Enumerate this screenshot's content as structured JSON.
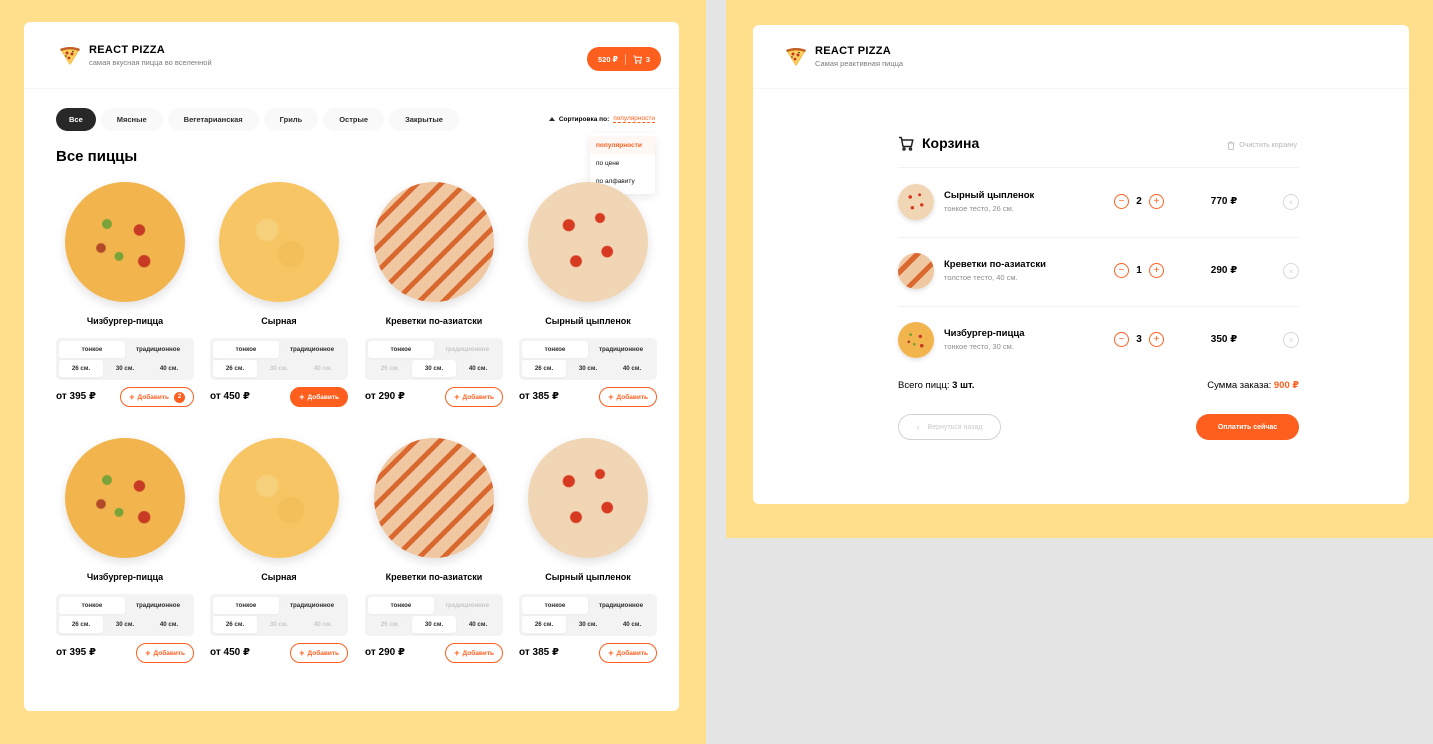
{
  "colors": {
    "accent": "#fe5f1e",
    "background": "#ffdf8c",
    "dark": "#282828"
  },
  "catalog": {
    "header": {
      "title": "REACT PIZZA",
      "subtitle": "самая вкусная пицца во вселенной",
      "cart_price": "520 ₽",
      "cart_count": "3",
      "cart_icon": "cart-icon"
    },
    "categories": [
      "Все",
      "Мясные",
      "Вегетарианская",
      "Гриль",
      "Острые",
      "Закрытые"
    ],
    "active_category": "Все",
    "sort": {
      "label": "Сортировка по:",
      "value": "популярности",
      "options": [
        "популярности",
        "по цене",
        "по алфавиту"
      ]
    },
    "section_title": "Все пиццы",
    "add_label": "Добавить",
    "pizzas": [
      {
        "name": "Чизбургер-пицца",
        "price": "от 395 ₽",
        "types": [
          "тонкое",
          "традиционное"
        ],
        "sizes": [
          "26 см.",
          "30 см.",
          "40 см."
        ],
        "added_count": "2"
      },
      {
        "name": "Сырная",
        "price": "от 450 ₽",
        "types": [
          "тонкое",
          "традиционное"
        ],
        "sizes": [
          "26 см.",
          "30 см.",
          "40 см."
        ]
      },
      {
        "name": "Креветки по-азиатски",
        "price": "от 290 ₽",
        "types": [
          "тонкое",
          "традиционное"
        ],
        "sizes": [
          "26 см.",
          "30 см.",
          "40 см."
        ]
      },
      {
        "name": "Сырный цыпленок",
        "price": "от 385 ₽",
        "types": [
          "тонкое",
          "традиционное"
        ],
        "sizes": [
          "26 см.",
          "30 см.",
          "40 см."
        ]
      },
      {
        "name": "Чизбургер-пицца",
        "price": "от 395 ₽",
        "types": [
          "тонкое",
          "традиционное"
        ],
        "sizes": [
          "26 см.",
          "30 см.",
          "40 см."
        ]
      },
      {
        "name": "Сырная",
        "price": "от 450 ₽",
        "types": [
          "тонкое",
          "традиционное"
        ],
        "sizes": [
          "26 см.",
          "30 см.",
          "40 см."
        ]
      },
      {
        "name": "Креветки по-азиатски",
        "price": "от 290 ₽",
        "types": [
          "тонкое",
          "традиционное"
        ],
        "sizes": [
          "26 см.",
          "30 см.",
          "40 см."
        ]
      },
      {
        "name": "Сырный цыпленок",
        "price": "от 385 ₽",
        "types": [
          "тонкое",
          "традиционное"
        ],
        "sizes": [
          "26 см.",
          "30 см.",
          "40 см."
        ]
      }
    ]
  },
  "cart": {
    "header": {
      "title": "REACT PIZZA",
      "subtitle": "Самая реактивная пицца"
    },
    "title": "Корзина",
    "clear_label": "Очистить корзину",
    "items": [
      {
        "name": "Сырный цыпленок",
        "desc": "тонкое тесто, 26 см.",
        "qty": "2",
        "price": "770 ₽"
      },
      {
        "name": "Креветки по-азиатски",
        "desc": "толстое тесто, 40 см.",
        "qty": "1",
        "price": "290 ₽"
      },
      {
        "name": "Чизбургер-пицца",
        "desc": "тонкое тесто, 30 см.",
        "qty": "3",
        "price": "350 ₽"
      }
    ],
    "total_count_label": "Всего пицц:",
    "total_count_value": "3 шт.",
    "total_sum_label": "Сумма заказа:",
    "total_sum_value": "900 ₽",
    "back_label": "Вернуться назад",
    "pay_label": "Оплатить сейчас"
  }
}
